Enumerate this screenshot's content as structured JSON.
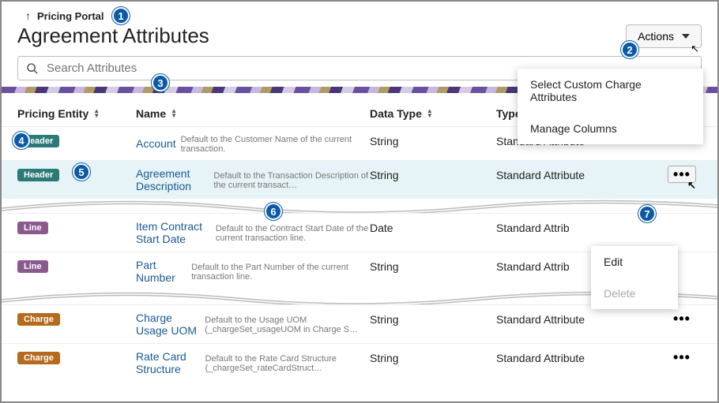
{
  "breadcrumb": {
    "label": "Pricing Portal"
  },
  "page_title": "Agreement Attributes",
  "actions_button": {
    "label": "Actions"
  },
  "actions_menu": {
    "items": [
      {
        "label": "Select Custom Charge Attributes"
      },
      {
        "label": "Manage Columns"
      }
    ]
  },
  "search": {
    "placeholder": "Search Attributes"
  },
  "columns": {
    "pricing_entity": "Pricing Entity",
    "name": "Name",
    "data_type": "Data Type",
    "type": "Type"
  },
  "rows": [
    {
      "entity": "Header",
      "entity_class": "header",
      "name": "Account",
      "desc": "Default to the Customer Name of the current transaction.",
      "dtype": "String",
      "type": "Standard Attribute",
      "highlight": false,
      "more_boxed": false
    },
    {
      "entity": "Header",
      "entity_class": "header",
      "name": "Agreement Description",
      "desc": "Default to the Transaction Description of the current transact…",
      "dtype": "String",
      "type": "Standard Attribute",
      "highlight": true,
      "more_boxed": true
    },
    {
      "entity": "Line",
      "entity_class": "line",
      "name": "Item Contract Start Date",
      "desc": "Default to the Contract Start Date of the current transaction line.",
      "dtype": "Date",
      "type": "Standard Attrib",
      "highlight": false,
      "more_boxed": false,
      "hide_more": true
    },
    {
      "entity": "Line",
      "entity_class": "line",
      "name": "Part Number",
      "desc": "Default to the Part Number of the current transaction line.",
      "dtype": "String",
      "type": "Standard Attrib",
      "highlight": false,
      "more_boxed": false,
      "hide_more": true
    },
    {
      "entity": "Charge",
      "entity_class": "charge",
      "name": "Charge Usage UOM",
      "desc": "Default to the Usage UOM (_chargeSet_usageUOM in Charge S…",
      "dtype": "String",
      "type": "Standard Attribute",
      "highlight": false,
      "more_boxed": false
    },
    {
      "entity": "Charge",
      "entity_class": "charge",
      "name": "Rate Card Structure",
      "desc": "Default to the Rate Card Structure (_chargeSet_rateCardStruct…",
      "dtype": "String",
      "type": "Standard Attribute",
      "highlight": false,
      "more_boxed": false
    }
  ],
  "row_menu": {
    "edit": "Edit",
    "delete": "Delete"
  },
  "callouts": {
    "c1": "1",
    "c2": "2",
    "c3": "3",
    "c4": "4",
    "c5": "5",
    "c6": "6",
    "c7": "7"
  }
}
